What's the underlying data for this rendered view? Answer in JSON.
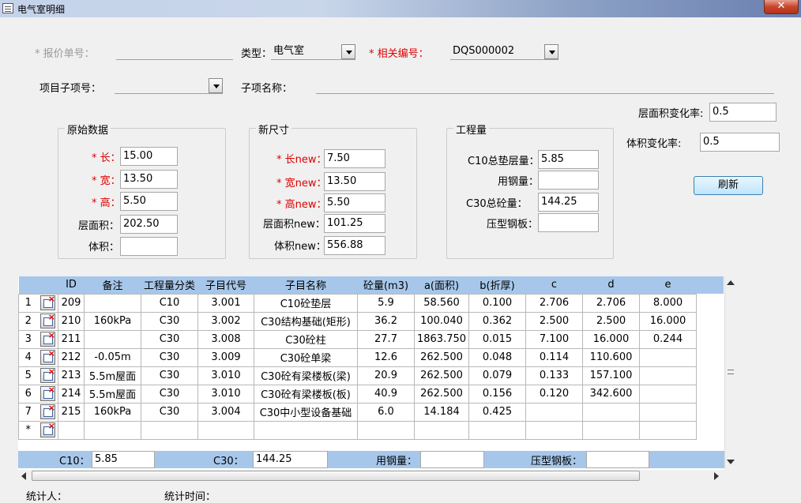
{
  "window": {
    "title": "电气室明细",
    "close": "✕"
  },
  "form": {
    "quote_no_label": "* 报价单号：",
    "type_label": "类型：",
    "type_value": "电气室",
    "related_no_label": "* 相关编号：",
    "related_no_value": "DQS000002",
    "project_sub_label": "项目子项号：",
    "sub_name_label": "子项名称：",
    "area_rate_label": "层面积变化率:",
    "area_rate_value": "0.5",
    "volume_rate_label": "体积变化率:",
    "volume_rate_value": "0.5",
    "refresh_button": "刷新"
  },
  "original": {
    "title": "原始数据",
    "length_label": "* 长：",
    "length_value": "15.00",
    "width_label": "* 宽：",
    "width_value": "13.50",
    "height_label": "* 高：",
    "height_value": "5.50",
    "area_label": "层面积：",
    "area_value": "202.50",
    "volume_label": "体积：",
    "volume_value": ""
  },
  "newsize": {
    "title": "新尺寸",
    "length_label": "* 长new：",
    "length_value": "7.50",
    "width_label": "* 宽new：",
    "width_value": "13.50",
    "height_label": "* 高new：",
    "height_value": "5.50",
    "area_label": "层面积new：",
    "area_value": "101.25",
    "volume_label": "体积new：",
    "volume_value": "556.88"
  },
  "quantity": {
    "title": "工程量",
    "c10_label": "C10总垫层量：",
    "c10_value": "5.85",
    "steel_label": "用钢量：",
    "steel_value": "",
    "c30_label": "C30总砼量：",
    "c30_value": "144.25",
    "plate_label": "压型钢板：",
    "plate_value": ""
  },
  "table": {
    "headers": [
      "ID",
      "备注",
      "工程量分类",
      "子目代号",
      "子目名称",
      "砼量(m3)",
      "a(面积)",
      "b(折厚)",
      "c",
      "d",
      "e"
    ],
    "rows": [
      {
        "n": "1",
        "id": "209",
        "note": "",
        "cls": "C10",
        "code": "3.001",
        "name": "C10砼垫层",
        "vol": "5.9",
        "a": "58.560",
        "b": "0.100",
        "c": "2.706",
        "d": "2.706",
        "e": "8.000"
      },
      {
        "n": "2",
        "id": "210",
        "note": "160kPa",
        "cls": "C30",
        "code": "3.002",
        "name": "C30结构基础(矩形)",
        "vol": "36.2",
        "a": "100.040",
        "b": "0.362",
        "c": "2.500",
        "d": "2.500",
        "e": "16.000"
      },
      {
        "n": "3",
        "id": "211",
        "note": "",
        "cls": "C30",
        "code": "3.008",
        "name": "C30砼柱",
        "vol": "27.7",
        "a": "1863.750",
        "b": "0.015",
        "c": "7.100",
        "d": "16.000",
        "e": "0.244"
      },
      {
        "n": "4",
        "id": "212",
        "note": "-0.05m",
        "cls": "C30",
        "code": "3.009",
        "name": "C30砼单梁",
        "vol": "12.6",
        "a": "262.500",
        "b": "0.048",
        "c": "0.114",
        "d": "110.600",
        "e": ""
      },
      {
        "n": "5",
        "id": "213",
        "note": "5.5m屋面",
        "cls": "C30",
        "code": "3.010",
        "name": "C30砼有梁楼板(梁)",
        "vol": "20.9",
        "a": "262.500",
        "b": "0.079",
        "c": "0.133",
        "d": "157.100",
        "e": ""
      },
      {
        "n": "6",
        "id": "214",
        "note": "5.5m屋面",
        "cls": "C30",
        "code": "3.010",
        "name": "C30砼有梁楼板(板)",
        "vol": "40.9",
        "a": "262.500",
        "b": "0.156",
        "c": "0.120",
        "d": "342.600",
        "e": ""
      },
      {
        "n": "7",
        "id": "215",
        "note": "160kPa",
        "cls": "C30",
        "code": "3.004",
        "name": "C30中小型设备基础",
        "vol": "6.0",
        "a": "14.184",
        "b": "0.425",
        "c": "",
        "d": "",
        "e": ""
      },
      {
        "n": "*",
        "id": "",
        "note": "",
        "cls": "",
        "code": "",
        "name": "",
        "vol": "",
        "a": "",
        "b": "",
        "c": "",
        "d": "",
        "e": ""
      }
    ]
  },
  "footer": {
    "c10_label": "C10：",
    "c10_value": "5.85",
    "c30_label": "C30：",
    "c30_value": "144.25",
    "steel_label": "用钢量：",
    "steel_value": "",
    "plate_label": "压型钢板：",
    "plate_value": ""
  },
  "bottom": {
    "stat_person_label": "统计人：",
    "stat_time_label": "统计时间："
  }
}
